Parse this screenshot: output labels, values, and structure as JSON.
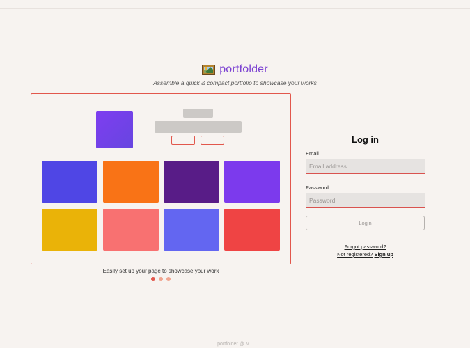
{
  "brand": {
    "name": "portfolder",
    "logo_icon": "framed-picture-icon",
    "name_color": "#7a3fd1"
  },
  "tagline": "Assemble a quick & compact portfolio to showcase your works",
  "preview": {
    "accent": "#e2574c",
    "tiles": [
      {
        "color": "#4f46e5"
      },
      {
        "color": "#f97316"
      },
      {
        "color": "#581c87"
      },
      {
        "color": "#7c3aed"
      },
      {
        "color": "#eab308"
      },
      {
        "color": "#f87171"
      },
      {
        "color": "#6366f1"
      },
      {
        "color": "#ef4444"
      }
    ]
  },
  "carousel": {
    "caption": "Easily set up your page to showcase your work",
    "slides": 3,
    "active": 1
  },
  "login": {
    "title": "Log in",
    "email_label": "Email",
    "email_placeholder": "Email address",
    "email_value": "",
    "password_label": "Password",
    "password_placeholder": "Password",
    "password_value": "",
    "button_label": "Login",
    "forgot_label": "Forgot password?",
    "not_registered_label": "Not registered?",
    "signup_label": "Sign up"
  },
  "footer": "portfolder @ MT"
}
